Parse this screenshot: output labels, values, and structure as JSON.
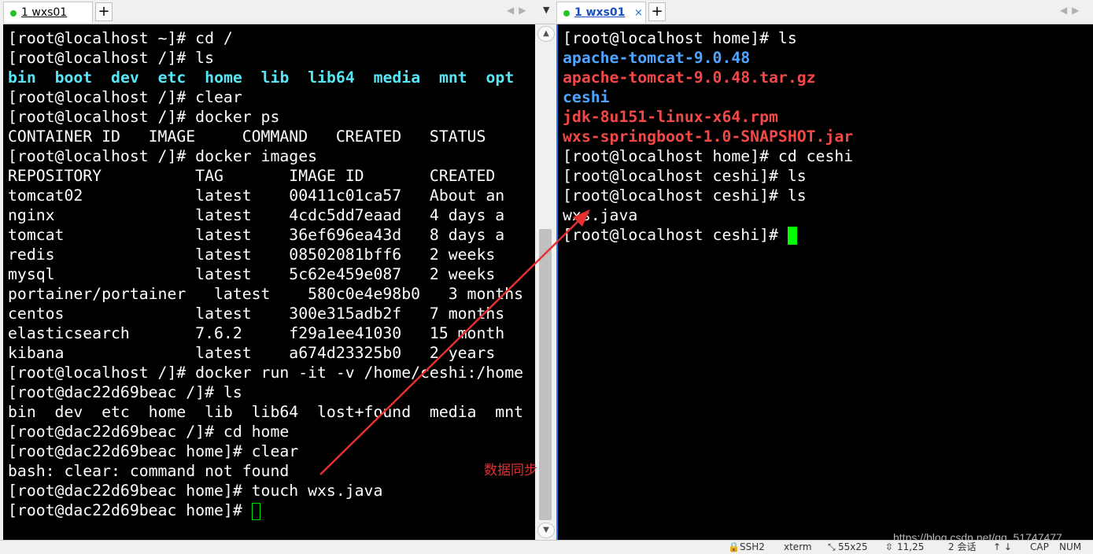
{
  "left_tab": {
    "number": "1",
    "title": "wxs01"
  },
  "right_tab": {
    "number": "1",
    "title": "wxs01",
    "close": "×"
  },
  "add_tab_label": "+",
  "left_terminal": [
    [
      {
        "t": "[root@localhost ~]# cd /"
      }
    ],
    [
      {
        "t": "[root@localhost /]# ls"
      }
    ],
    [
      {
        "t": "bin",
        "c": "cyan-bold"
      },
      {
        "t": "  "
      },
      {
        "t": "boot",
        "c": "cyan-bold"
      },
      {
        "t": "  "
      },
      {
        "t": "dev",
        "c": "cyan-bold"
      },
      {
        "t": "  "
      },
      {
        "t": "etc",
        "c": "cyan-bold"
      },
      {
        "t": "  "
      },
      {
        "t": "home",
        "c": "cyan-bold"
      },
      {
        "t": "  "
      },
      {
        "t": "lib",
        "c": "cyan-bold"
      },
      {
        "t": "  "
      },
      {
        "t": "lib64",
        "c": "cyan-bold"
      },
      {
        "t": "  "
      },
      {
        "t": "media",
        "c": "cyan-bold"
      },
      {
        "t": "  "
      },
      {
        "t": "mnt",
        "c": "cyan-bold"
      },
      {
        "t": "  "
      },
      {
        "t": "opt",
        "c": "cyan-bold"
      }
    ],
    [
      {
        "t": "[root@localhost /]# clear"
      }
    ],
    [
      {
        "t": "[root@localhost /]# docker ps"
      }
    ],
    [
      {
        "t": "CONTAINER ID   IMAGE     COMMAND   CREATED   STATUS"
      }
    ],
    [
      {
        "t": "[root@localhost /]# docker images"
      }
    ],
    [
      {
        "t": "REPOSITORY          TAG       IMAGE ID       CREATED"
      }
    ],
    [
      {
        "t": "tomcat02            latest    00411c01ca57   About an"
      }
    ],
    [
      {
        "t": "nginx               latest    4cdc5dd7eaad   4 days a"
      }
    ],
    [
      {
        "t": "tomcat              latest    36ef696ea43d   8 days a"
      }
    ],
    [
      {
        "t": "redis               latest    08502081bff6   2 weeks"
      }
    ],
    [
      {
        "t": "mysql               latest    5c62e459e087   2 weeks"
      }
    ],
    [
      {
        "t": "portainer/portainer   latest    580c0e4e98b0   3 months"
      }
    ],
    [
      {
        "t": "centos              latest    300e315adb2f   7 months"
      }
    ],
    [
      {
        "t": "elasticsearch       7.6.2     f29a1ee41030   15 month"
      }
    ],
    [
      {
        "t": "kibana              latest    a674d23325b0   2 years"
      }
    ],
    [
      {
        "t": "[root@localhost /]# docker run -it -v /home/ceshi:/home"
      }
    ],
    [
      {
        "t": "[root@dac22d69beac /]# ls"
      }
    ],
    [
      {
        "t": "bin  dev  etc  home  lib  lib64  lost+found  media  mnt"
      }
    ],
    [
      {
        "t": "[root@dac22d69beac /]# cd home"
      }
    ],
    [
      {
        "t": "[root@dac22d69beac home]# clear"
      }
    ],
    [
      {
        "t": "bash: clear: command not found"
      }
    ],
    [
      {
        "t": "[root@dac22d69beac home]# touch wxs.java"
      }
    ],
    [
      {
        "t": "[root@dac22d69beac home]# "
      }
    ]
  ],
  "right_terminal": [
    [
      {
        "t": "[root@localhost home]# ls"
      }
    ],
    [
      {
        "t": "apache-tomcat-9.0.48",
        "c": "blue-bold"
      }
    ],
    [
      {
        "t": "apache-tomcat-9.0.48.tar.gz",
        "c": "red-bold"
      }
    ],
    [
      {
        "t": "ceshi",
        "c": "blue-bold"
      }
    ],
    [
      {
        "t": "jdk-8u151-linux-x64.rpm",
        "c": "red-bold"
      }
    ],
    [
      {
        "t": "wxs-springboot-1.0-SNAPSHOT.jar",
        "c": "red-bold"
      }
    ],
    [
      {
        "t": "[root@localhost home]# cd ceshi"
      }
    ],
    [
      {
        "t": "[root@localhost ceshi]# ls"
      }
    ],
    [
      {
        "t": "[root@localhost ceshi]# ls"
      }
    ],
    [
      {
        "t": "wxs.java"
      }
    ],
    [
      {
        "t": "[root@localhost ceshi]# "
      }
    ]
  ],
  "annotation": "数据同步",
  "watermark": "https://blog.csdn.net/qq_51747477",
  "status_bar": {
    "protocol": "SSH2",
    "terminal_type": "xterm",
    "size": "55x25",
    "cursor_pos": "11,25",
    "sessions": "2 会话",
    "caps": "CAP",
    "num": "NUM"
  },
  "colors": {
    "terminal_bg": "#000000",
    "cursor": "#00ff00",
    "arrow": "#e53030",
    "active_tab_border": "#2a7de1"
  }
}
